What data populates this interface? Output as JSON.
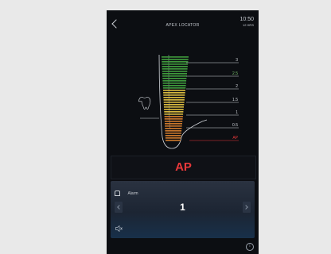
{
  "header": {
    "title": "APEX LOCATOR",
    "time": "10:50",
    "time_unit": "12 HRS"
  },
  "gauge": {
    "scale_labels": [
      "3",
      "2.5",
      "2",
      "1.5",
      "1",
      "0.5",
      "AP"
    ],
    "colors": {
      "green": "#3f9a3c",
      "yellow": "#d7b93f",
      "orange": "#c9772c",
      "apex": "#e8383a"
    }
  },
  "readout": {
    "status": "AP",
    "status_color": "#e8383a"
  },
  "controls": {
    "alarm_label": "Alarm",
    "alarm_value": "1"
  },
  "icons": [
    "back-icon",
    "tooth-icon",
    "bell-icon",
    "sound-icon",
    "info-icon",
    "chevron-left-icon",
    "chevron-right-icon"
  ]
}
